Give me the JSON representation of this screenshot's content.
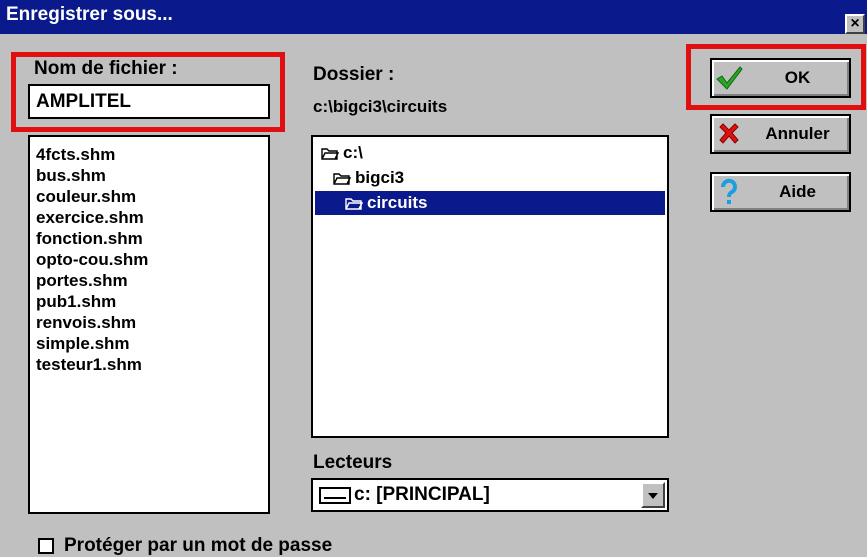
{
  "window": {
    "title": "Enregistrer sous...",
    "close_label": "×"
  },
  "filename": {
    "label": "Nom de fichier :",
    "value": "AMPLITEL"
  },
  "files": [
    "4fcts.shm",
    "bus.shm",
    "couleur.shm",
    "exercice.shm",
    "fonction.shm",
    "opto-cou.shm",
    "portes.shm",
    "pub1.shm",
    "renvois.shm",
    "simple.shm",
    "testeur1.shm"
  ],
  "folder": {
    "label": "Dossier :",
    "path": "c:\\bigci3\\circuits",
    "items": [
      {
        "name": "c:\\",
        "icon": "open-folder-icon"
      },
      {
        "name": "bigci3",
        "icon": "open-folder-icon"
      },
      {
        "name": "circuits",
        "icon": "open-folder-icon",
        "selected": true
      }
    ]
  },
  "drives": {
    "label": "Lecteurs",
    "selected": "c: [PRINCIPAL]"
  },
  "buttons": {
    "ok": "OK",
    "cancel": "Annuler",
    "help": "Aide"
  },
  "password": {
    "label": "Protéger par un mot de passe",
    "checked": false
  },
  "colors": {
    "titlebar": "#0a1a8c",
    "highlight": "#0a1a8c",
    "annotation": "#e01010",
    "background": "#c0c0c0"
  }
}
